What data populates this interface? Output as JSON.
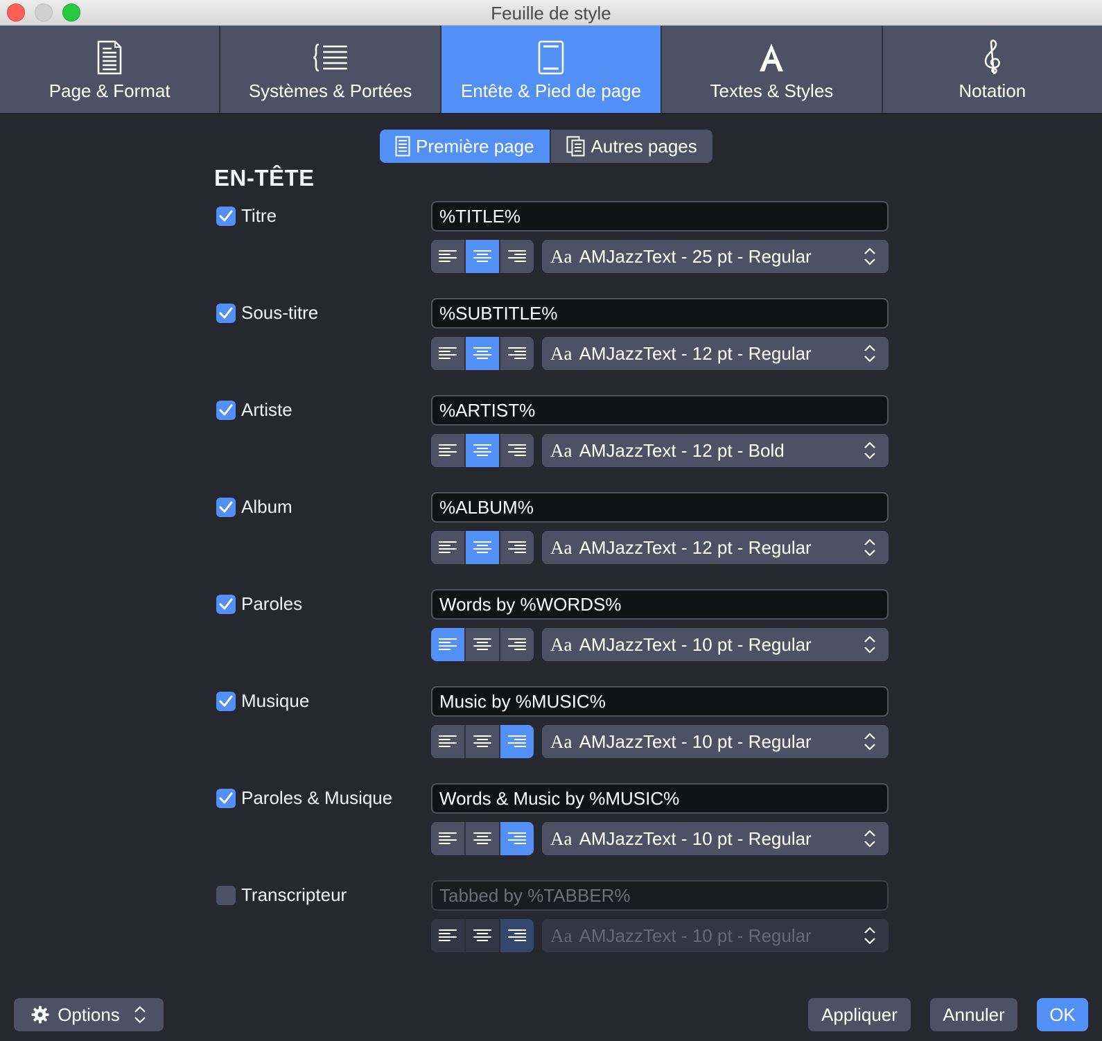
{
  "window": {
    "title": "Feuille de style"
  },
  "tabs": [
    {
      "label": "Page & Format",
      "icon": "page-icon",
      "active": false
    },
    {
      "label": "Systèmes & Portées",
      "icon": "list-brace-icon",
      "active": false
    },
    {
      "label": "Entête & Pied de page",
      "icon": "header-footer-icon",
      "active": true
    },
    {
      "label": "Textes & Styles",
      "icon": "letter-a-icon",
      "active": false
    },
    {
      "label": "Notation",
      "icon": "treble-clef-icon",
      "active": false
    }
  ],
  "pages": {
    "first": "Première page",
    "others": "Autres pages"
  },
  "section": {
    "title": "EN-TÊTE"
  },
  "font_prefix": "Aa",
  "rows": [
    {
      "label": "Titre",
      "checked": true,
      "value": "%TITLE%",
      "align": "center",
      "font": "AMJazzText - 25 pt - Regular"
    },
    {
      "label": "Sous-titre",
      "checked": true,
      "value": "%SUBTITLE%",
      "align": "center",
      "font": "AMJazzText - 12 pt - Regular"
    },
    {
      "label": "Artiste",
      "checked": true,
      "value": "%ARTIST%",
      "align": "center",
      "font": "AMJazzText - 12 pt - Bold"
    },
    {
      "label": "Album",
      "checked": true,
      "value": "%ALBUM%",
      "align": "center",
      "font": "AMJazzText - 12 pt - Regular"
    },
    {
      "label": "Paroles",
      "checked": true,
      "value": "Words by %WORDS%",
      "align": "left",
      "font": "AMJazzText - 10 pt - Regular"
    },
    {
      "label": "Musique",
      "checked": true,
      "value": "Music by %MUSIC%",
      "align": "right",
      "font": "AMJazzText - 10 pt - Regular"
    },
    {
      "label": "Paroles & Musique",
      "checked": true,
      "value": "Words & Music by %MUSIC%",
      "align": "right",
      "font": "AMJazzText - 10 pt - Regular"
    },
    {
      "label": "Transcripteur",
      "checked": false,
      "value": "Tabbed by %TABBER%",
      "align": "right",
      "font": "AMJazzText - 10 pt - Regular"
    }
  ],
  "footer": {
    "options": "Options",
    "apply": "Appliquer",
    "cancel": "Annuler",
    "ok": "OK"
  },
  "colors": {
    "accent": "#5390f5",
    "background": "#262830",
    "control": "#4c5264",
    "field": "#111216"
  }
}
